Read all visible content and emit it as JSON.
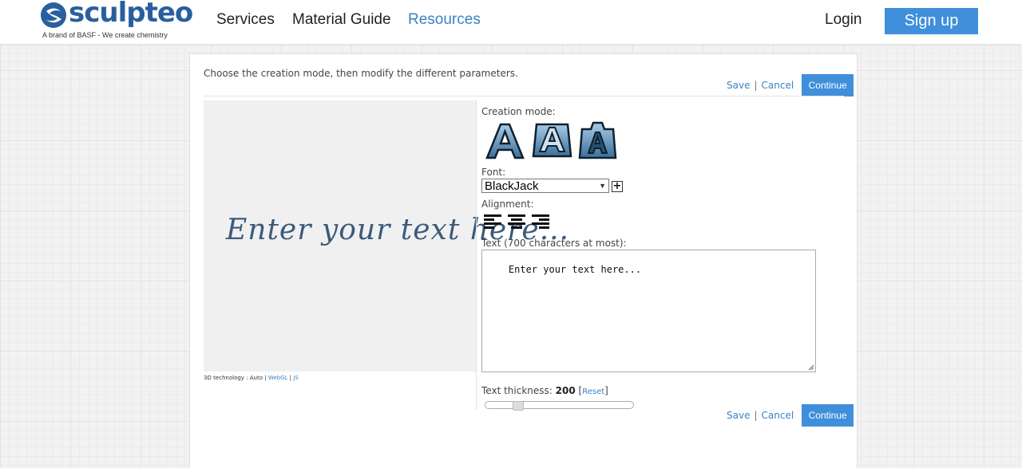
{
  "header": {
    "logo_text": "sculpteo",
    "logo_tagline": "A brand of BASF - We create chemistry",
    "nav": [
      "Services",
      "Material Guide",
      "Resources"
    ],
    "login": "Login",
    "signup": "Sign up"
  },
  "editor": {
    "intro": "Choose the creation mode, then modify the different parameters.",
    "save": "Save",
    "separator": "|",
    "cancel": "Cancel",
    "continue": "Continue",
    "preview_text": "Enter your text here...",
    "tech_label": "3D technology : Auto |",
    "tech_webgl": "WebGL",
    "tech_sep": "|",
    "tech_js": "JS",
    "creation_mode_label": "Creation mode:",
    "creation_modes": [
      "extruded-letter-icon",
      "embossed-plate-icon",
      "engraved-block-icon"
    ],
    "font_label": "Font:",
    "font_value": "BlackJack",
    "font_add": "+",
    "alignment_label": "Alignment:",
    "alignments": [
      "align-left-icon",
      "align-center-icon",
      "align-right-icon"
    ],
    "text_label": "Text (700 characters at most):",
    "text_value": "Enter your text here...",
    "thickness_label": "Text thickness:",
    "thickness_value": "200",
    "thickness_open": "[",
    "thickness_reset": "Reset",
    "thickness_close": "]",
    "thickness_slider_fraction": 0.2
  },
  "colors": {
    "accent": "#3f8fdb",
    "link": "#3b82c4",
    "logo": "#2a5f9e"
  }
}
